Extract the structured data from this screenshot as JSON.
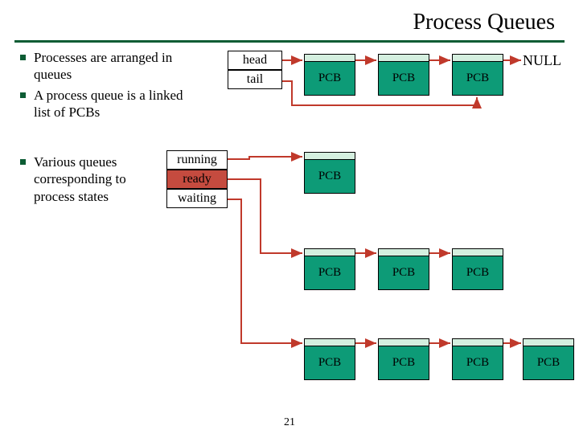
{
  "title": "Process Queues",
  "bullets1": [
    "Processes are arranged in queues",
    "A process queue is a linked list of PCBs"
  ],
  "bullets2": [
    "Various queues corresponding to process states"
  ],
  "headtail": {
    "head": "head",
    "tail": "tail"
  },
  "states": {
    "running": "running",
    "ready": "ready",
    "waiting": "waiting"
  },
  "pcb_label": "PCB",
  "null_label": "NULL",
  "slide_number": "21"
}
